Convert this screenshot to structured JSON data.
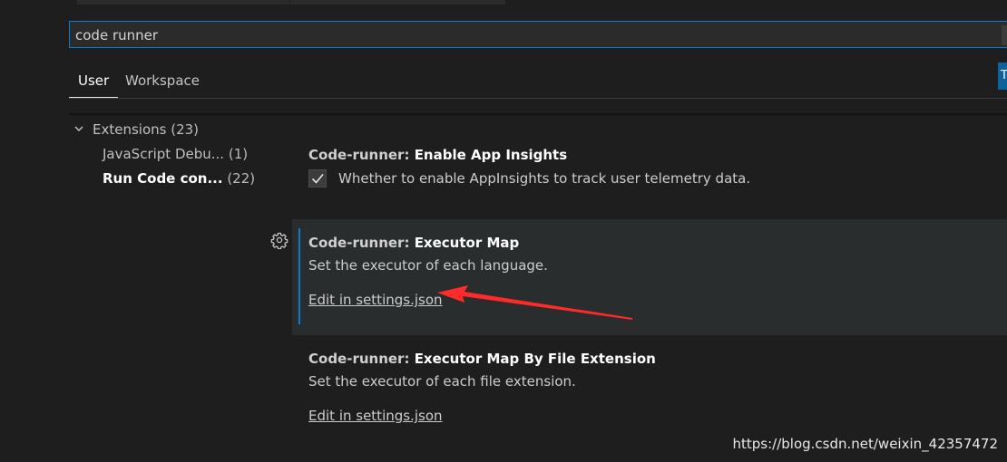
{
  "search": {
    "value": "code runner"
  },
  "tabs": [
    {
      "label": "User"
    },
    {
      "label": "Workspace"
    }
  ],
  "right_button_glyph": "T",
  "toc": {
    "group": {
      "label": "Extensions",
      "count": "(23)"
    },
    "items": [
      {
        "label": "JavaScript Debu...",
        "count": "(1)"
      },
      {
        "label": "Run Code con...",
        "count": "(22)"
      }
    ]
  },
  "settings": [
    {
      "category": "Code-runner: ",
      "name": "Enable App Insights",
      "description": "Whether to enable AppInsights to track user telemetry data.",
      "checked": true
    },
    {
      "category": "Code-runner: ",
      "name": "Executor Map",
      "description": "Set the executor of each language.",
      "link": "Edit in settings.json"
    },
    {
      "category": "Code-runner: ",
      "name": "Executor Map By File Extension",
      "description": "Set the executor of each file extension.",
      "link": "Edit in settings.json"
    }
  ],
  "watermark": "https://blog.csdn.net/weixin_42357472",
  "colors": {
    "background": "#1e1e1e",
    "focus_border": "#007fd4",
    "annotation_arrow": "#ff2a2a",
    "hover_row": "#2a2d2e"
  },
  "icons": {
    "gear": "gear-icon",
    "chevron": "chevron-down-icon",
    "check": "check-icon"
  }
}
